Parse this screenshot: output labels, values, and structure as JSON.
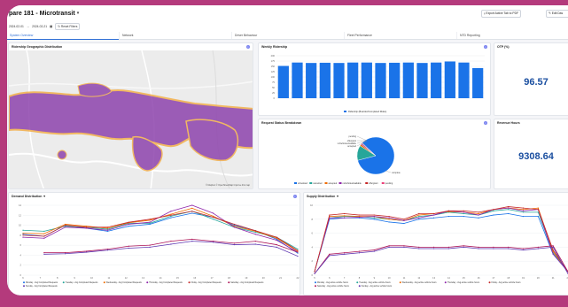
{
  "app": {
    "title": "pare 181 - Microtransit",
    "actions": {
      "export_label": "Export Active Tab to PDF",
      "edit_label": "Edit Das"
    }
  },
  "filters": {
    "date_start": "2024-02-01",
    "date_end": "2024-02-21",
    "reset_label": "Reset Filters"
  },
  "tabs": [
    {
      "label": "System Overview",
      "active": true
    },
    {
      "label": "Network",
      "active": false
    },
    {
      "label": "Driver Behaviour",
      "active": false
    },
    {
      "label": "Fleet Performance",
      "active": false
    },
    {
      "label": "NTD Reporting",
      "active": false
    }
  ],
  "map": {
    "title": "Ridership Geographic Distribution",
    "attribution": "© Mapbox © OpenStreetMap Improve this map"
  },
  "weekly": {
    "title": "Weekly Ridership",
    "legend": "Ridership (Boarder/Completed Rides)",
    "color": "#1a73e8",
    "yticks": [
      "200",
      "175",
      "150",
      "125",
      "100",
      "75",
      "50",
      "25",
      "0"
    ],
    "values": [
      152,
      168,
      166,
      167,
      166,
      168,
      168,
      166,
      167,
      168,
      166,
      168,
      173,
      168,
      142
    ]
  },
  "otp": {
    "title": "OTP (%)",
    "value": "96.57"
  },
  "request_status": {
    "title": "Request Status Breakdown",
    "slice_labels": [
      "pending",
      "offergrant",
      "noVehiclesAvailable",
      "accepted",
      "complete"
    ],
    "legend": [
      "scheduled",
      "cancelled",
      "accepted",
      "noVehiclesAvailable",
      "offergrant",
      "pending"
    ],
    "legend_colors": [
      "#1a73e8",
      "#26a69a",
      "#ef6c00",
      "#8e24aa",
      "#c62828",
      "#ec407a"
    ],
    "slices": [
      {
        "name": "complete",
        "value": 84,
        "color": "#1a73e8"
      },
      {
        "name": "accepted",
        "value": 13,
        "color": "#26a69a"
      },
      {
        "name": "noVehiclesAvailable",
        "value": 1.5,
        "color": "#ef6c00"
      },
      {
        "name": "offergrant",
        "value": 1,
        "color": "#8e24aa"
      },
      {
        "name": "pending",
        "value": 0.5,
        "color": "#c62828"
      }
    ]
  },
  "revenue_hours": {
    "title": "Revenue Hours",
    "value": "9308.64"
  },
  "demand": {
    "title": "Demand Distribution",
    "yticks": [
      "14",
      "12",
      "10",
      "8",
      "6",
      "4",
      "2",
      "0"
    ],
    "xticks": [
      "6",
      "7",
      "8",
      "9",
      "10",
      "11",
      "12",
      "13",
      "14",
      "15",
      "16",
      "17",
      "18",
      "19",
      "20",
      "21",
      "22"
    ],
    "legend": [
      "Monday - Avg Completed Requests",
      "Tuesday - Avg Completed Requests",
      "Wednesday - Avg Completed Requests",
      "Thursday - Avg Completed Requests",
      "Friday - Avg Completed Requests",
      "Saturday - Avg Completed Requests",
      "Sunday - Avg Completed Requests"
    ],
    "series": [
      {
        "color": "#1a73e8",
        "values": [
          8.2,
          7.8,
          10,
          9.4,
          8.8,
          9.8,
          10.2,
          11.5,
          12.4,
          11.6,
          10,
          8.9,
          7.2,
          4.4
        ]
      },
      {
        "color": "#26a69a",
        "values": [
          9,
          8.8,
          9.8,
          9.6,
          9.2,
          10.4,
          10.4,
          11.8,
          12.8,
          11.2,
          9.6,
          8.6,
          7.6,
          5.2
        ]
      },
      {
        "color": "#ef6c00",
        "values": [
          8.4,
          8.3,
          10.2,
          9.8,
          9.4,
          10.5,
          11,
          12.2,
          13.4,
          11.8,
          9.8,
          8.8,
          7.4,
          4.8
        ]
      },
      {
        "color": "#8e24aa",
        "values": [
          7.6,
          7.4,
          9.6,
          9.4,
          9,
          10.2,
          10.6,
          12.8,
          14,
          12.4,
          9.6,
          8.2,
          7,
          4.6
        ]
      },
      {
        "color": "#c62828",
        "values": [
          8,
          7.8,
          10,
          9.6,
          9.6,
          10.6,
          11.2,
          12,
          12.8,
          11.6,
          10.2,
          8.9,
          7.6,
          4.9
        ]
      },
      {
        "color": "#ad1457",
        "values": [
          null,
          4.5,
          4.5,
          4.8,
          5.2,
          5.8,
          6,
          6.8,
          7.2,
          6.8,
          6.4,
          6.8,
          6.1,
          4.6
        ]
      },
      {
        "color": "#5e35b1",
        "values": [
          null,
          4.2,
          4.3,
          4.6,
          5,
          5.4,
          5.6,
          6.2,
          6.8,
          6.6,
          6.1,
          6.2,
          5.6,
          3.8
        ]
      }
    ]
  },
  "supply": {
    "title": "Supply Distribution",
    "yticks": [
      "10",
      "8",
      "6",
      "4",
      "2",
      "0"
    ],
    "xticks": [
      "5",
      "6",
      "7",
      "8",
      "9",
      "10",
      "11",
      "12",
      "13",
      "14",
      "15",
      "16",
      "17",
      "18",
      "19",
      "20",
      "21",
      "22"
    ],
    "legend": [
      "Monday - Avg active vehicle hours",
      "Tuesday - Avg active vehicle hours",
      "Wednesday - Avg active vehicle hours",
      "Thursday - Avg active vehicle hours",
      "Friday - Avg active vehicle hours",
      "Saturday - Avg active vehicle hours",
      "Sunday - Avg active vehicle hours"
    ],
    "series": [
      {
        "color": "#1a73e8",
        "values": [
          0.5,
          8,
          8.2,
          8.2,
          8,
          7.6,
          7.4,
          8,
          8.2,
          8.4,
          8.4,
          8.2,
          8.6,
          8.8,
          8.4,
          8.4,
          3,
          0.5
        ]
      },
      {
        "color": "#26a69a",
        "values": [
          0.5,
          8.2,
          8.4,
          8.4,
          8.2,
          8,
          7.8,
          8.4,
          8.6,
          9,
          8.8,
          8.6,
          9.2,
          9.4,
          9,
          9,
          3.2,
          0.5
        ]
      },
      {
        "color": "#ef6c00",
        "values": [
          0.5,
          8.4,
          8.5,
          8.4,
          8.4,
          8,
          7.8,
          8.6,
          8.8,
          9.1,
          9,
          8.8,
          9.4,
          9.6,
          9.4,
          9.6,
          3.4,
          0.5
        ]
      },
      {
        "color": "#8e24aa",
        "values": [
          0.5,
          8.2,
          8.2,
          8.3,
          8.4,
          8.2,
          7.8,
          8.2,
          8.6,
          9.2,
          9,
          8.6,
          9.4,
          9.6,
          9.2,
          9.4,
          3,
          0.5
        ]
      },
      {
        "color": "#c62828",
        "values": [
          0.5,
          8.6,
          8.8,
          8.6,
          8.6,
          8.4,
          8,
          8.8,
          8.8,
          9.2,
          9.2,
          9,
          9.4,
          9.8,
          9.6,
          9.4,
          3.6,
          0.5
        ]
      },
      {
        "color": "#ad1457",
        "values": [
          0.2,
          3,
          3.2,
          3.4,
          3.6,
          4.2,
          4.2,
          4,
          4,
          4,
          4.2,
          4,
          4,
          4,
          3.8,
          4,
          4.2,
          0.5
        ]
      },
      {
        "color": "#5e35b1",
        "values": [
          0.2,
          2.8,
          3,
          3.2,
          3.4,
          4,
          4,
          3.8,
          3.8,
          3.8,
          4,
          3.8,
          3.8,
          3.8,
          3.6,
          3.8,
          4,
          0.2
        ]
      }
    ]
  }
}
